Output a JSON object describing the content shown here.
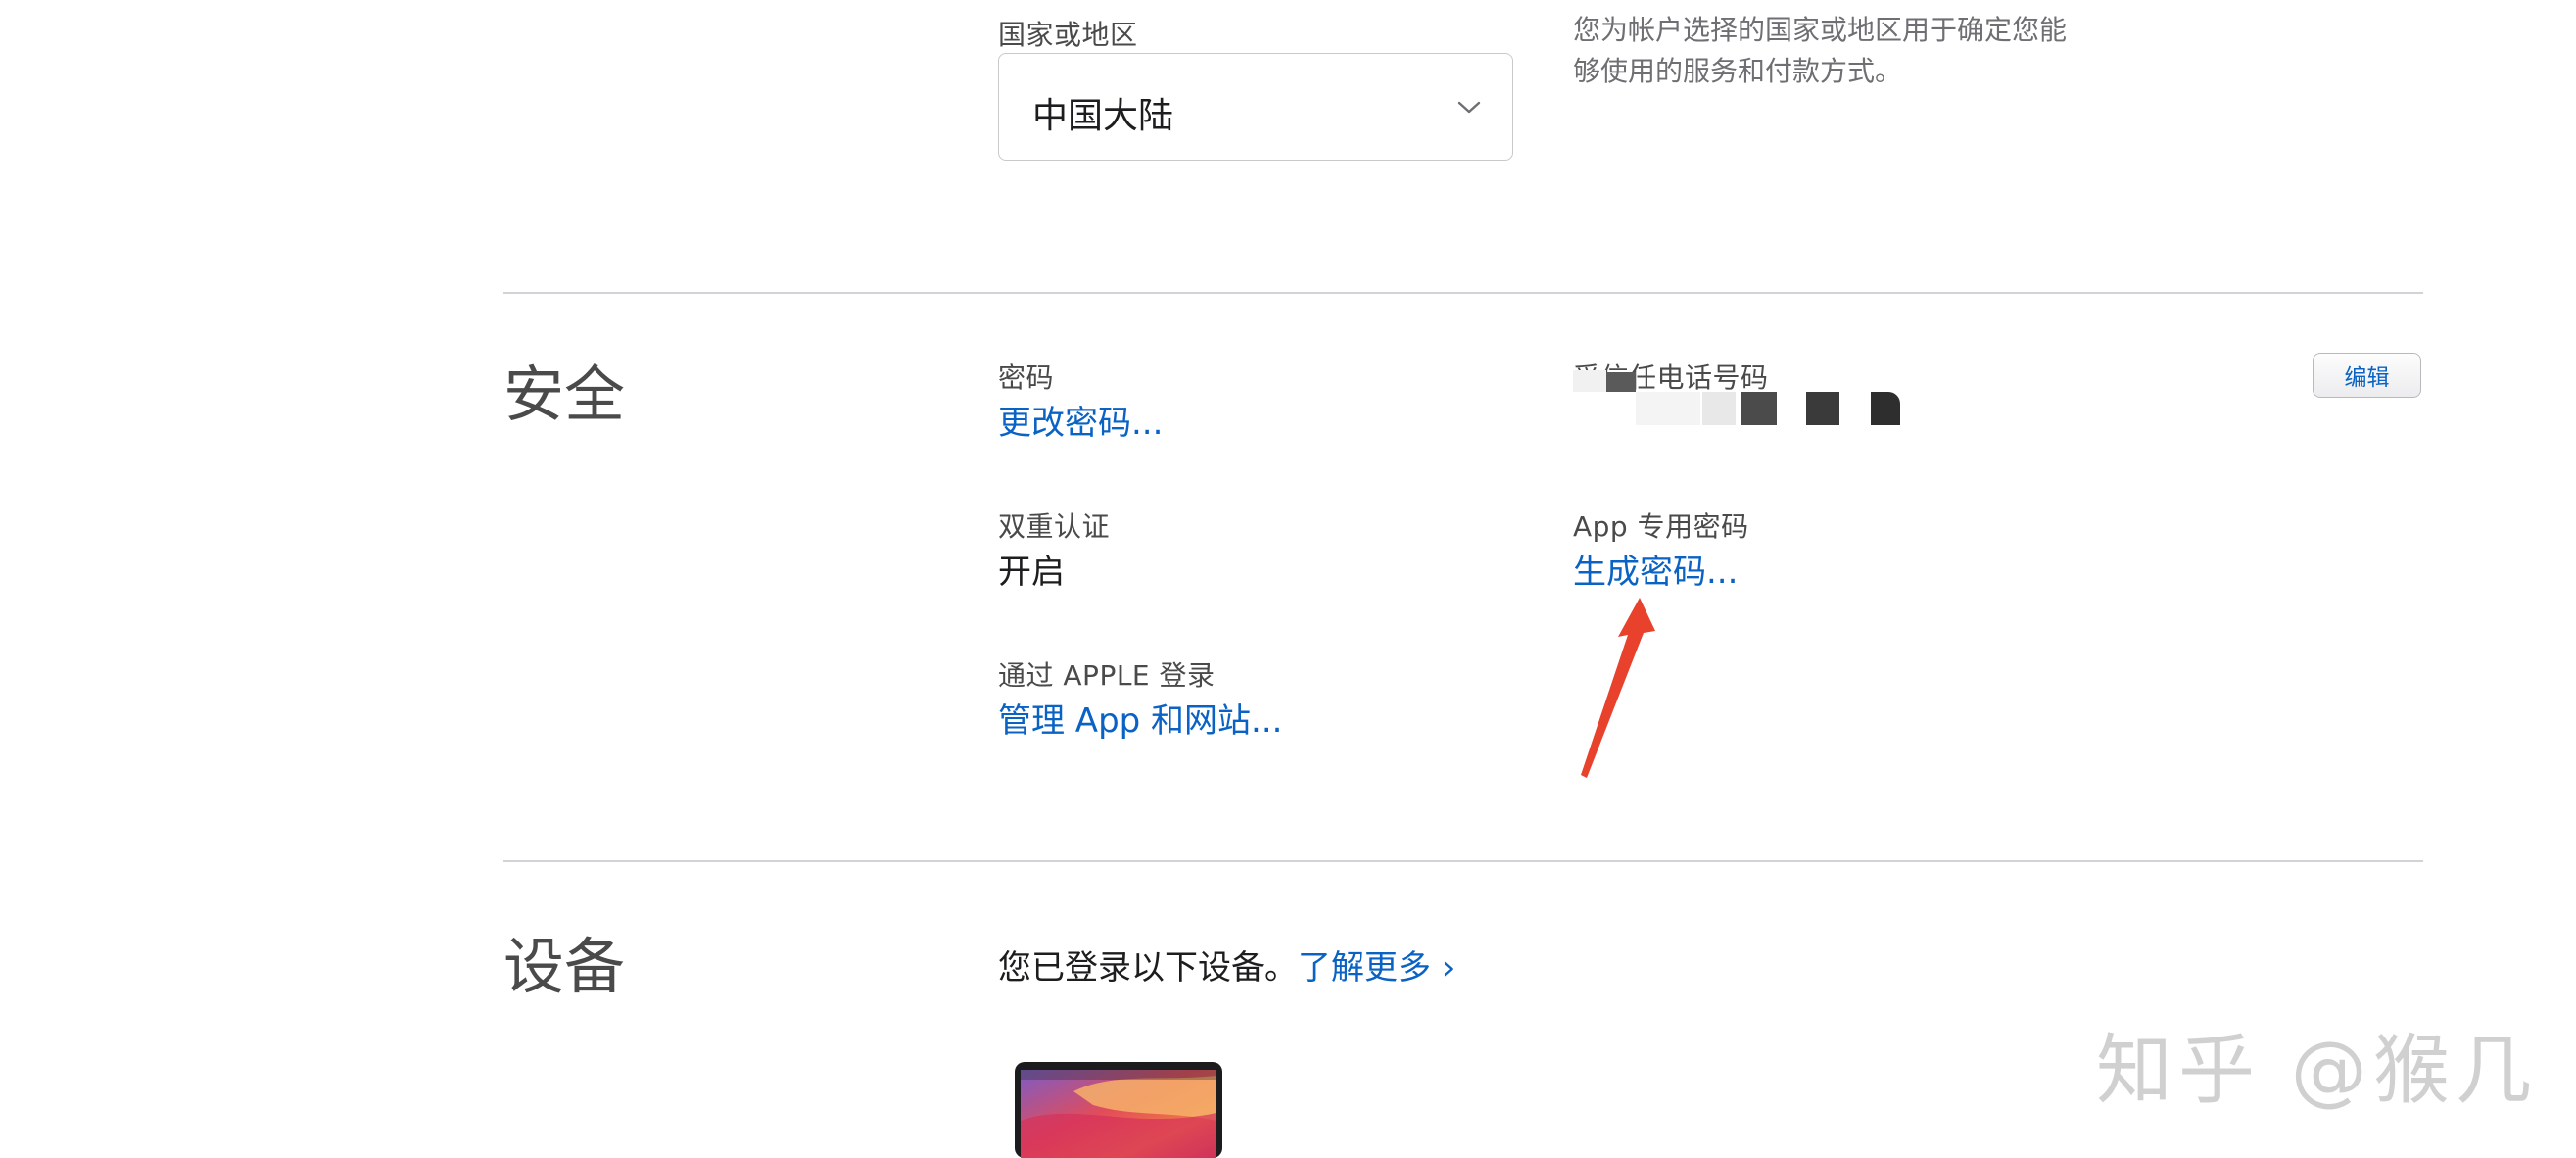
{
  "region": {
    "label": "国家或地区",
    "selected": "中国大陆",
    "hint_line1": "您为帐户选择的国家或地区用于确定您能",
    "hint_line2": "够使用的服务和付款方式。"
  },
  "security": {
    "title": "安全",
    "password_label": "密码",
    "password_link": "更改密码...",
    "trusted_phone_label": "受信任电话号码",
    "edit_button": "编辑",
    "two_factor_label": "双重认证",
    "two_factor_value": "开启",
    "app_password_label": "App 专用密码",
    "app_password_link": "生成密码...",
    "siwa_label": "通过 APPLE 登录",
    "siwa_link": "管理 App 和网站..."
  },
  "devices": {
    "title": "设备",
    "description": "您已登录以下设备。",
    "learn_more": "了解更多 ›"
  },
  "watermark": "知乎 @猴几",
  "colors": {
    "link": "#0a63c4",
    "annotation_arrow": "#e8412c",
    "divider": "#d2d2d7"
  },
  "icons": {
    "select": "chevron-down-icon",
    "annotation": "red-arrow-icon",
    "device": "macbook-icon"
  }
}
